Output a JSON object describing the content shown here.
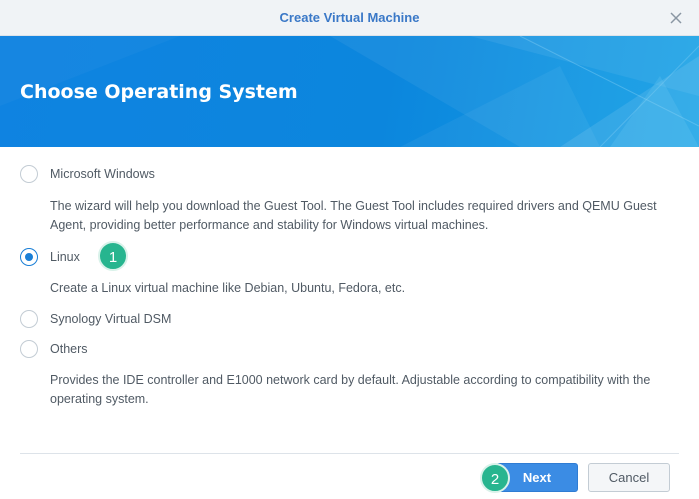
{
  "dialog": {
    "title": "Create Virtual Machine",
    "close_icon": "close-icon"
  },
  "banner": {
    "heading": "Choose Operating System"
  },
  "options": [
    {
      "label": "Microsoft Windows",
      "checked": false,
      "description": "The wizard will help you download the Guest Tool. The Guest Tool includes required drivers and QEMU Guest Agent, providing better performance and stability for Windows virtual machines."
    },
    {
      "label": "Linux",
      "checked": true,
      "description": "Create a Linux virtual machine like Debian, Ubuntu, Fedora, etc."
    },
    {
      "label": "Synology Virtual DSM",
      "checked": false,
      "description": ""
    },
    {
      "label": "Others",
      "checked": false,
      "description": "Provides the IDE controller and E1000 network card by default. Adjustable according to compatibility with the operating system."
    }
  ],
  "step_markers": [
    "1",
    "2"
  ],
  "footer": {
    "next_label": "Next",
    "cancel_label": "Cancel"
  },
  "colors": {
    "accent": "#1a7fd6",
    "title": "#3a78c7",
    "banner": "#0c86dd",
    "step_badge": "#27b58f"
  }
}
